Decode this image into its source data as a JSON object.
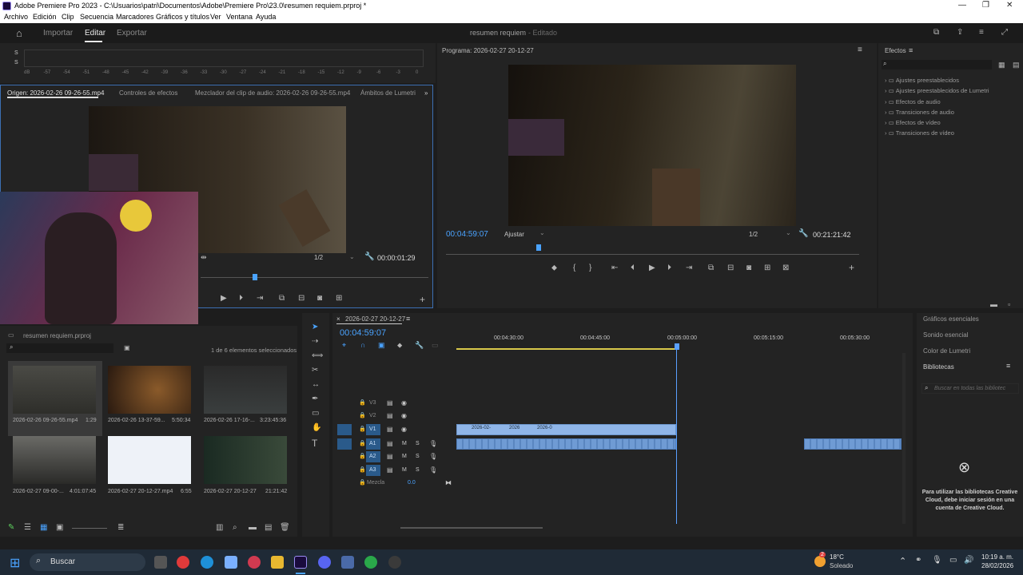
{
  "window": {
    "title": "Adobe Premiere Pro 2023 - C:\\Usuarios\\patri\\Documentos\\Adobe\\Premiere Pro\\23.0\\resumen requiem.prproj *"
  },
  "menu": [
    "Archivo",
    "Edición",
    "Clip",
    "Secuencia",
    "Marcadores",
    "Gráficos y títulos",
    "Ver",
    "Ventana",
    "Ayuda"
  ],
  "workspace": {
    "tabs": [
      "Importar",
      "Editar",
      "Exportar"
    ],
    "project": "resumen requiem",
    "status": "- Editado"
  },
  "meter": {
    "scale": [
      "dB",
      "-57",
      "-54",
      "-51",
      "-48",
      "-45",
      "-42",
      "-39",
      "-36",
      "-33",
      "-30",
      "-27",
      "-24",
      "-21",
      "-18",
      "-15",
      "-12",
      "-9",
      "-6",
      "-3",
      "0"
    ]
  },
  "source": {
    "tabs": [
      "Origen: 2026-02-26 09-26-55.mp4",
      "Controles de efectos",
      "Mezclador del clip de audio: 2026-02-26 09-26-55.mp4",
      "Ámbitos de Lumetri"
    ],
    "resolution": "1/2",
    "timecode": "00:00:01:29"
  },
  "program": {
    "title": "Programa: 2026-02-27 20-12-27",
    "timecode": "00:04:59:07",
    "fit": "Ajustar",
    "resolution": "1/2",
    "duration": "00:21:21:42"
  },
  "effects": {
    "title": "Efectos",
    "items": [
      "Ajustes preestablecidos",
      "Ajustes preestablecidos de Lumetri",
      "Efectos de audio",
      "Transiciones de audio",
      "Efectos de vídeo",
      "Transiciones de vídeo"
    ]
  },
  "project_panel": {
    "file": "resumen requiem.prproj",
    "selection": "1 de 6 elementos seleccionados",
    "items": [
      {
        "name": "2026-02-26 09-26-55.mp4",
        "dur": "1:29"
      },
      {
        "name": "2026-02-26 13-37-59...",
        "dur": "5:50:34"
      },
      {
        "name": "2026-02-26 17-16-...",
        "dur": "3:23:45:36"
      },
      {
        "name": "2026-02-27 09-00-...",
        "dur": "4:01:07:45"
      },
      {
        "name": "2026-02-27 20-12-27.mp4",
        "dur": "6:55"
      },
      {
        "name": "2026-02-27 20-12-27",
        "dur": "21:21:42"
      }
    ]
  },
  "timeline": {
    "sequence": "2026-02-27 20-12-27",
    "timecode": "00:04:59:07",
    "ruler": [
      "00:04:30:00",
      "00:04:45:00",
      "00:05:00:00",
      "00:05:15:00",
      "00:05:30:00"
    ],
    "video_tracks": [
      "V3",
      "V2",
      "V1"
    ],
    "audio_tracks": [
      "A1",
      "A2",
      "A3"
    ],
    "mix_label": "Mezcla",
    "mix_value": "0.0",
    "clip_labels": [
      "2026-02-",
      "2026",
      "2026-0"
    ]
  },
  "right_panel": {
    "items": [
      "Gráficos esenciales",
      "Sonido esencial",
      "Color de Lumetri",
      "Bibliotecas"
    ],
    "search": "Buscar en todas las bibliotec",
    "message": "Para utilizar las bibliotecas Creative Cloud, debe iniciar sesión en una cuenta de Creative Cloud."
  },
  "taskbar": {
    "search": "Buscar",
    "weather_temp": "18°C",
    "weather_desc": "Soleado",
    "time": "10:19 a. m.",
    "date": "28/02/2026",
    "badge": "2"
  },
  "colors": {
    "accent": "#4aa3ff",
    "clip_video": "#8fb5e8",
    "clip_audio": "#6f9bd4",
    "playhead": "#5aa0ff"
  }
}
